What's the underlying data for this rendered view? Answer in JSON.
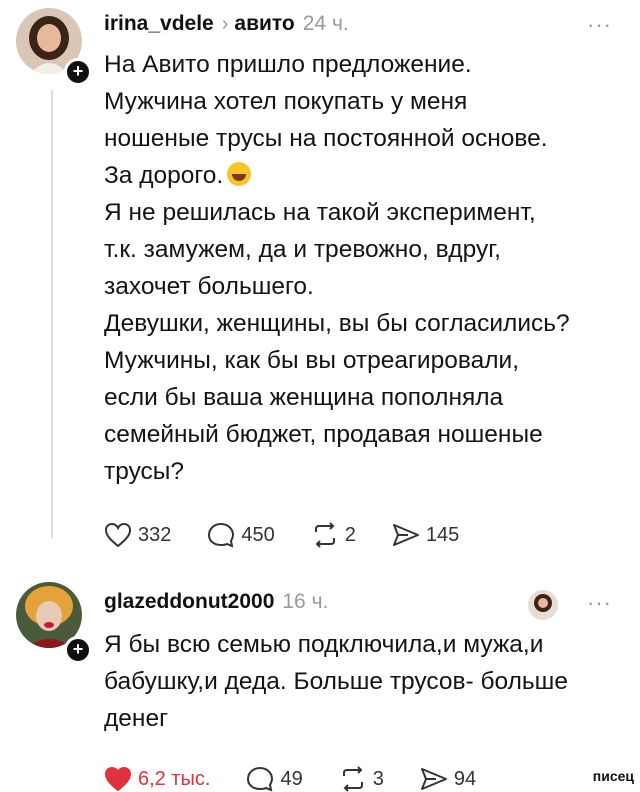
{
  "post1": {
    "username": "irina_vdele",
    "group": "авито",
    "time": "24 ч.",
    "more": "···",
    "lines": [
      "На Авито пришло предложение.",
      "Мужчина хотел покупать у меня",
      "ношеные трусы на постоянной основе.",
      "За дорого.",
      "Я не решилась на такой эксперимент,",
      "т.к. замужем, да и тревожно, вдруг,",
      "захочет большего.",
      "Девушки, женщины, вы бы согласились?",
      "Мужчины, как бы вы отреагировали,",
      "если бы ваша женщина пополняла",
      "семейный бюджет, продавая ношеные",
      "трусы?"
    ],
    "likes": "332",
    "comments": "450",
    "reposts": "2",
    "shares": "145"
  },
  "post2": {
    "username": "glazeddonut2000",
    "time": "16 ч.",
    "more": "···",
    "lines": [
      "Я бы всю семью подключила,и мужа,и",
      "бабушку,и деда. Больше трусов- больше",
      "денег"
    ],
    "likes": "6,2 тыс.",
    "comments": "49",
    "reposts": "3",
    "shares": "94"
  },
  "watermark": "писец",
  "colors": {
    "like_active": "#e0323c",
    "muted": "#9a9a9a",
    "text": "#141414"
  }
}
